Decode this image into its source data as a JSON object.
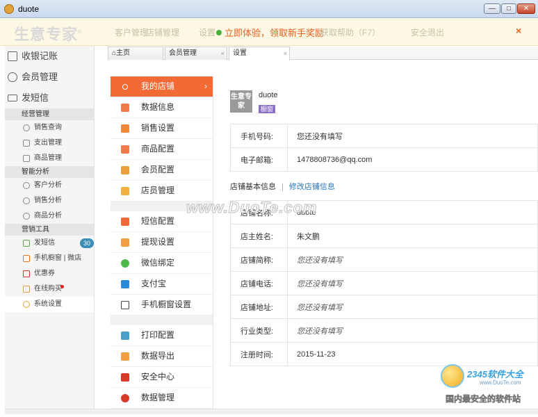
{
  "window": {
    "title": "duote"
  },
  "header": {
    "logo": "生意专家",
    "faded_left": "客户管理",
    "faded_left2": "店铺管理",
    "faded_settings": "设置",
    "promo": "立即体验，领取新手奖励",
    "faded_right1": "获取帮助（F7）",
    "faded_right2": "安全退出",
    "close": "×"
  },
  "sidebar": {
    "main": [
      {
        "label": "收银记账"
      },
      {
        "label": "会员管理"
      },
      {
        "label": "发短信"
      }
    ],
    "groups": [
      {
        "title": "经营管理",
        "items": [
          "销售查询",
          "支出管理",
          "商品管理"
        ]
      },
      {
        "title": "智能分析",
        "items": [
          "客户分析",
          "销售分析",
          "商品分析"
        ]
      },
      {
        "title": "营销工具",
        "items": [
          "发短信",
          "手机橱窗 | 微店",
          "优惠券",
          "在线购买",
          "系统设置"
        ]
      }
    ],
    "sms_badge": "30"
  },
  "tabs": [
    {
      "label": "主页"
    },
    {
      "label": "会员管理"
    },
    {
      "label": "设置"
    }
  ],
  "settings_menu": {
    "group1": [
      "我的店铺",
      "数据信息",
      "销售设置",
      "商品配置",
      "会员配置",
      "店员管理"
    ],
    "group2": [
      "短信配置",
      "提现设置",
      "微信绑定",
      "支付宝",
      "手机橱窗设置"
    ],
    "group3": [
      "打印配置",
      "数据导出",
      "安全中心",
      "数据管理"
    ]
  },
  "store": {
    "logo_text": "生意专家",
    "name": "duote",
    "tag": "橱窗",
    "contact": [
      {
        "label": "手机号码:",
        "value": "您还没有填写"
      },
      {
        "label": "电子邮箱:",
        "value": "1478808736@qq.com"
      }
    ],
    "section_title": "店铺基本信息",
    "section_edit": "修改店铺信息",
    "basic": [
      {
        "label": "店铺名称:",
        "value": "duote"
      },
      {
        "label": "店主姓名:",
        "value": "朱文鹏"
      },
      {
        "label": "店铺简称:",
        "value": "您还没有填写"
      },
      {
        "label": "店铺电话:",
        "value": "您还没有填写"
      },
      {
        "label": "店铺地址:",
        "value": "您还没有填写"
      },
      {
        "label": "行业类型:",
        "value": "您还没有填写"
      },
      {
        "label": "注册时间:",
        "value": "2015-11-23"
      }
    ]
  },
  "watermarks": {
    "center": "www.DuoTe.com",
    "brand": "2345软件大全",
    "url": "www.DuoTe.com",
    "slogan": "国内最安全的软件站"
  },
  "colors": {
    "accent": "#f26a35",
    "promo": "#e85d1a",
    "link": "#2a7ac0",
    "tag": "#8c6fc7",
    "badge": "#3a8fb7"
  }
}
